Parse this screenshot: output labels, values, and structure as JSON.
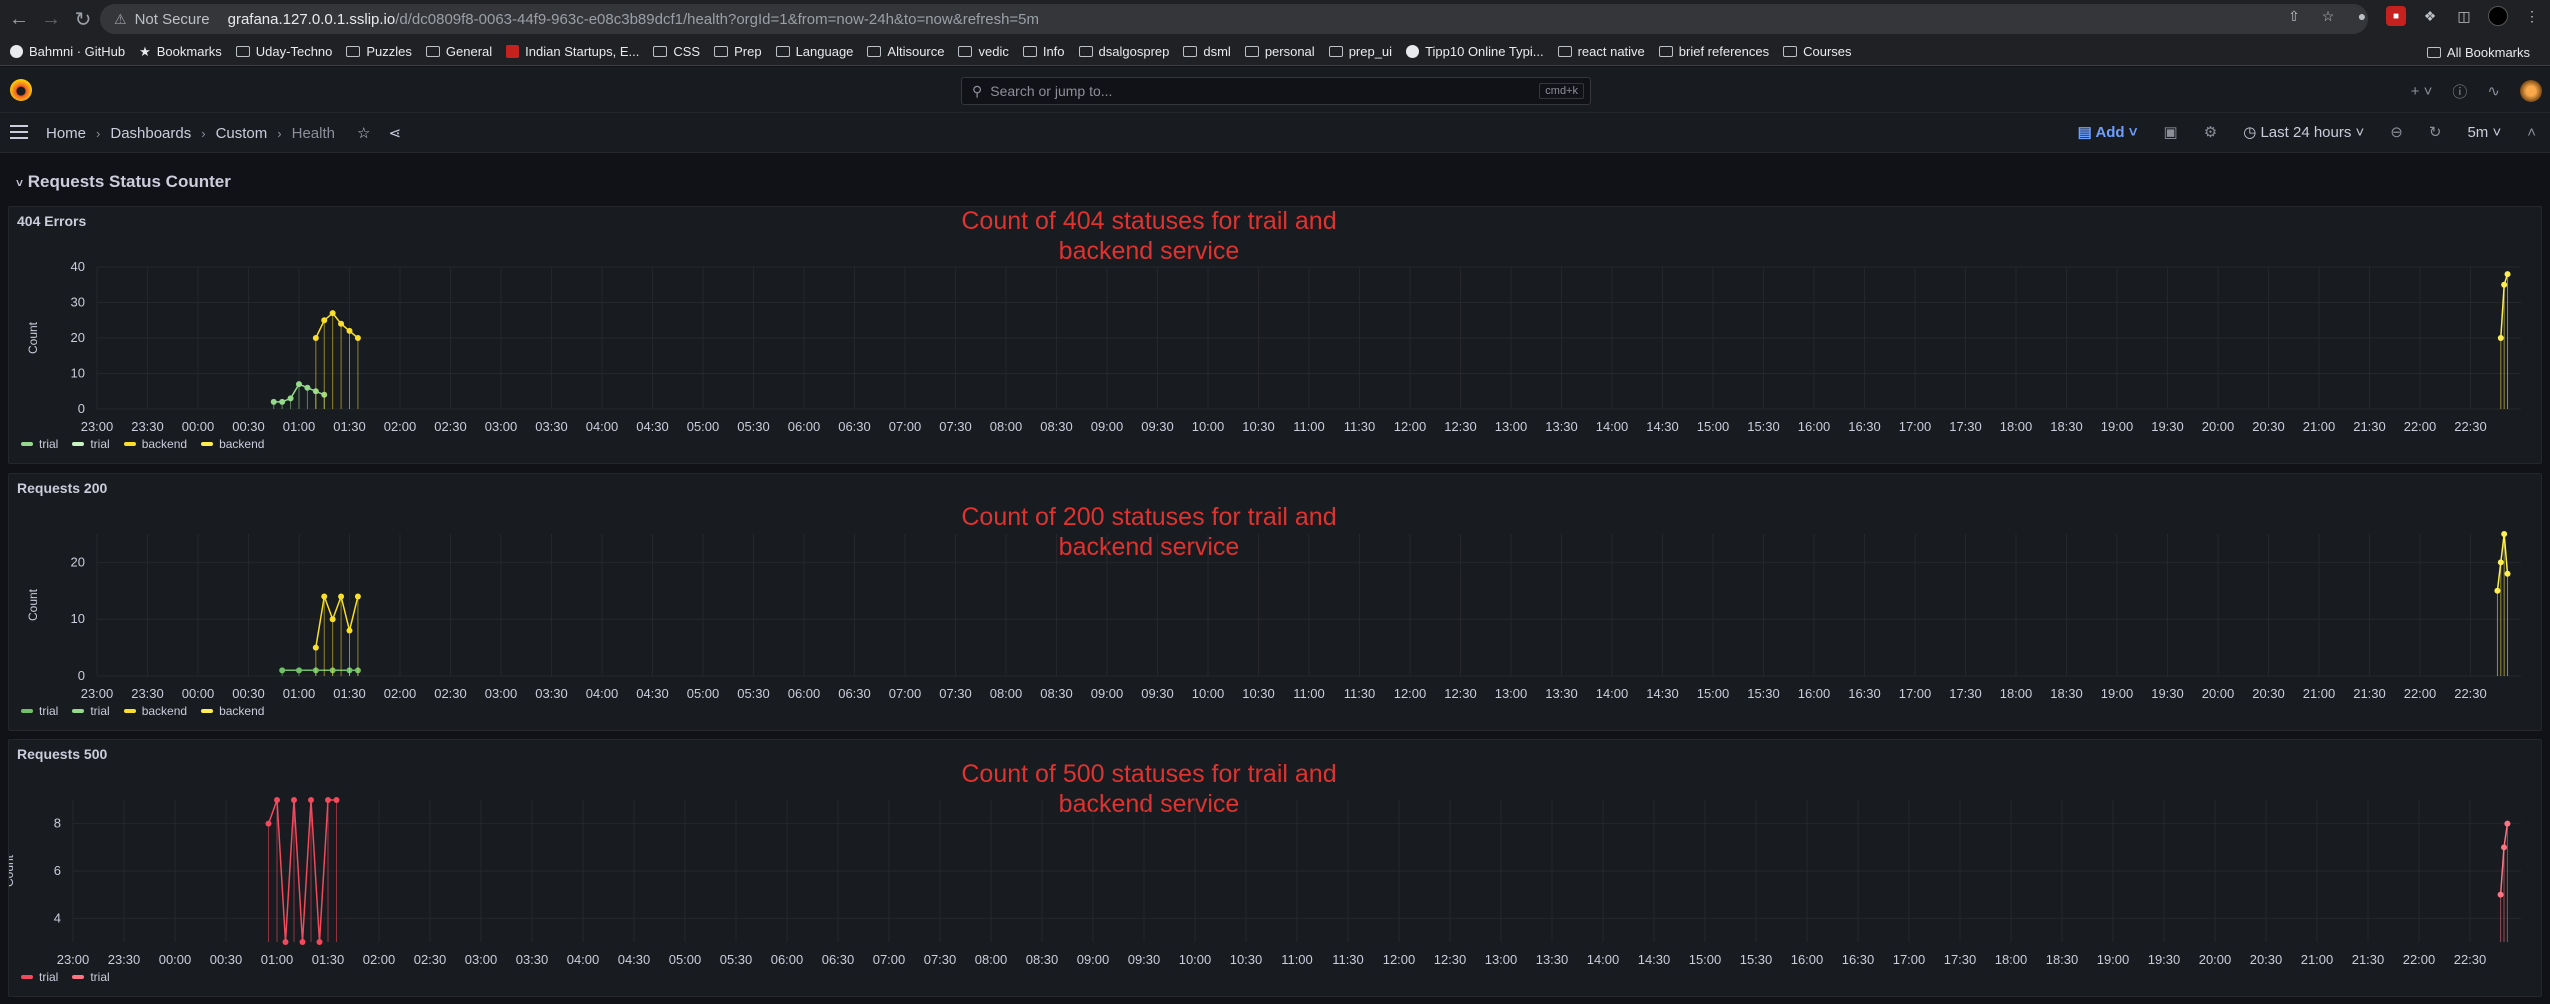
{
  "browser": {
    "not_secure": "Not Secure",
    "url_host": "grafana.127.0.0.1.sslip.io",
    "url_path": "/d/dc0809f8-0063-44f9-963c-e08c3b89dcf1/health?orgId=1&from=now-24h&to=now&refresh=5m",
    "bookmarks": [
      "Bahmni · GitHub",
      "Bookmarks",
      "Uday-Techno",
      "Puzzles",
      "General",
      "Indian Startups, E...",
      "CSS",
      "Prep",
      "Language",
      "Altisource",
      "vedic",
      "Info",
      "dsalgosprep",
      "dsml",
      "personal",
      "prep_ui",
      "Tipp10 Online Typi...",
      "react native",
      "brief references",
      "Courses"
    ],
    "all_bookmarks": "All Bookmarks"
  },
  "topbar": {
    "search_placeholder": "Search or jump to...",
    "shortcut": "cmd+k"
  },
  "breadcrumb": {
    "home": "Home",
    "dashboards": "Dashboards",
    "custom": "Custom",
    "current": "Health"
  },
  "toolbar": {
    "add": "Add",
    "time_range": "Last 24 hours",
    "refresh_interval": "5m"
  },
  "row": {
    "title": "Requests Status Counter"
  },
  "panels": [
    {
      "title": "404 Errors",
      "annotation_line1": "Count of 404 statuses for trail and",
      "annotation_line2": "backend service",
      "legend": [
        {
          "label": "trial",
          "color": "#96d98d"
        },
        {
          "label": "trial",
          "color": "#c8f2c2"
        },
        {
          "label": "backend",
          "color": "#fade2a"
        },
        {
          "label": "backend",
          "color": "#ffee52"
        }
      ]
    },
    {
      "title": "Requests 200",
      "annotation_line1": "Count of 200 statuses for trail and",
      "annotation_line2": "backend service",
      "legend": [
        {
          "label": "trial",
          "color": "#73bf69"
        },
        {
          "label": "trial",
          "color": "#96d98d"
        },
        {
          "label": "backend",
          "color": "#fade2a"
        },
        {
          "label": "backend",
          "color": "#ffee52"
        }
      ]
    },
    {
      "title": "Requests 500",
      "annotation_line1": "Count of 500 statuses for trail and",
      "annotation_line2": "backend service",
      "legend": [
        {
          "label": "trial",
          "color": "#f2495c"
        },
        {
          "label": "trial",
          "color": "#ff7383"
        }
      ]
    }
  ],
  "chart_data": [
    {
      "type": "line",
      "title": "404 Errors",
      "ylabel": "Count",
      "ylim": [
        0,
        40
      ],
      "yticks": [
        0,
        10,
        20,
        30,
        40
      ],
      "xticks": [
        "23:00",
        "23:30",
        "00:00",
        "00:30",
        "01:00",
        "01:30",
        "02:00",
        "02:30",
        "03:00",
        "03:30",
        "04:00",
        "04:30",
        "05:00",
        "05:30",
        "06:00",
        "06:30",
        "07:00",
        "07:30",
        "08:00",
        "08:30",
        "09:00",
        "09:30",
        "10:00",
        "10:30",
        "11:00",
        "11:30",
        "12:00",
        "12:30",
        "13:00",
        "13:30",
        "14:00",
        "14:30",
        "15:00",
        "15:30",
        "16:00",
        "16:30",
        "17:00",
        "17:30",
        "18:00",
        "18:30",
        "19:00",
        "19:30",
        "20:00",
        "20:30",
        "21:00",
        "21:30",
        "22:00",
        "22:30"
      ],
      "series": [
        {
          "name": "trial",
          "color": "#96d98d",
          "x": [
            "00:45",
            "00:50",
            "00:55",
            "01:00",
            "01:05",
            "01:10",
            "01:15"
          ],
          "values": [
            2,
            2,
            3,
            7,
            6,
            5,
            4
          ]
        },
        {
          "name": "backend",
          "color": "#fade2a",
          "x": [
            "01:10",
            "01:15",
            "01:20",
            "01:25",
            "01:30",
            "01:35"
          ],
          "values": [
            20,
            25,
            27,
            24,
            22,
            20
          ]
        },
        {
          "name": "backend",
          "color": "#ffee52",
          "x": [
            "22:48",
            "22:50",
            "22:52"
          ],
          "values": [
            20,
            35,
            38
          ]
        }
      ]
    },
    {
      "type": "line",
      "title": "Requests 200",
      "ylabel": "Count",
      "ylim": [
        0,
        25
      ],
      "yticks": [
        0,
        10,
        20
      ],
      "xticks": [
        "23:00",
        "23:30",
        "00:00",
        "00:30",
        "01:00",
        "01:30",
        "02:00",
        "02:30",
        "03:00",
        "03:30",
        "04:00",
        "04:30",
        "05:00",
        "05:30",
        "06:00",
        "06:30",
        "07:00",
        "07:30",
        "08:00",
        "08:30",
        "09:00",
        "09:30",
        "10:00",
        "10:30",
        "11:00",
        "11:30",
        "12:00",
        "12:30",
        "13:00",
        "13:30",
        "14:00",
        "14:30",
        "15:00",
        "15:30",
        "16:00",
        "16:30",
        "17:00",
        "17:30",
        "18:00",
        "18:30",
        "19:00",
        "19:30",
        "20:00",
        "20:30",
        "21:00",
        "21:30",
        "22:00",
        "22:30"
      ],
      "series": [
        {
          "name": "trial",
          "color": "#73bf69",
          "x": [
            "00:50",
            "01:00",
            "01:10",
            "01:20",
            "01:30",
            "01:35"
          ],
          "values": [
            1,
            1,
            1,
            1,
            1,
            1
          ]
        },
        {
          "name": "backend",
          "color": "#fade2a",
          "x": [
            "01:10",
            "01:15",
            "01:20",
            "01:25",
            "01:30",
            "01:35"
          ],
          "values": [
            5,
            14,
            10,
            14,
            8,
            14
          ]
        },
        {
          "name": "backend",
          "color": "#ffee52",
          "x": [
            "22:46",
            "22:48",
            "22:50",
            "22:52"
          ],
          "values": [
            15,
            20,
            25,
            18
          ]
        }
      ]
    },
    {
      "type": "line",
      "title": "Requests 500",
      "ylabel": "Count",
      "ylim": [
        3,
        9
      ],
      "yticks": [
        4,
        6,
        8
      ],
      "xticks": [
        "23:00",
        "23:30",
        "00:00",
        "00:30",
        "01:00",
        "01:30",
        "02:00",
        "02:30",
        "03:00",
        "03:30",
        "04:00",
        "04:30",
        "05:00",
        "05:30",
        "06:00",
        "06:30",
        "07:00",
        "07:30",
        "08:00",
        "08:30",
        "09:00",
        "09:30",
        "10:00",
        "10:30",
        "11:00",
        "11:30",
        "12:00",
        "12:30",
        "13:00",
        "13:30",
        "14:00",
        "14:30",
        "15:00",
        "15:30",
        "16:00",
        "16:30",
        "17:00",
        "17:30",
        "18:00",
        "18:30",
        "19:00",
        "19:30",
        "20:00",
        "20:30",
        "21:00",
        "21:30",
        "22:00",
        "22:30"
      ],
      "series": [
        {
          "name": "trial",
          "color": "#f2495c",
          "x": [
            "00:55",
            "01:00",
            "01:05",
            "01:10",
            "01:15",
            "01:20",
            "01:25",
            "01:30",
            "01:35"
          ],
          "values": [
            8,
            9,
            3,
            9,
            3,
            9,
            3,
            9,
            9
          ]
        },
        {
          "name": "trial",
          "color": "#ff7383",
          "x": [
            "22:48",
            "22:50",
            "22:52"
          ],
          "values": [
            5,
            7,
            8
          ]
        }
      ]
    }
  ]
}
